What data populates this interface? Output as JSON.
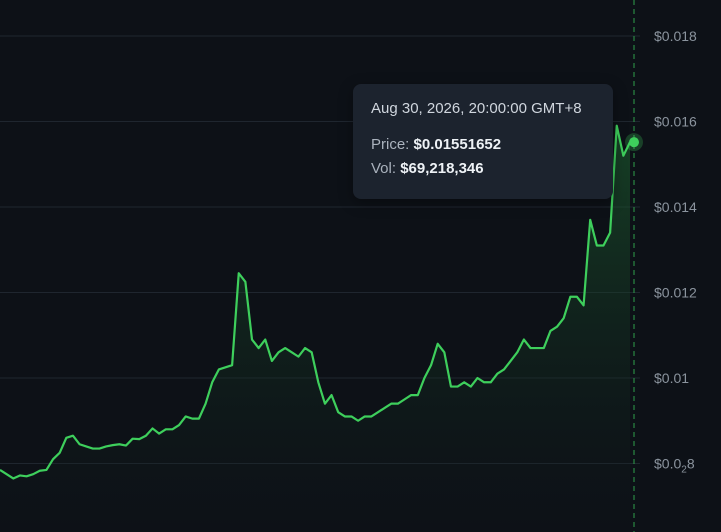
{
  "chart_data": {
    "type": "area",
    "title": "",
    "xlabel": "",
    "ylabel": "",
    "ylim": [
      0.0075,
      0.019
    ],
    "y_ticks": [
      {
        "value": 0.018,
        "label": "$0.018"
      },
      {
        "value": 0.016,
        "label": "$0.016"
      },
      {
        "value": 0.014,
        "label": "$0.014"
      },
      {
        "value": 0.012,
        "label": "$0.012"
      },
      {
        "value": 0.01,
        "label": "$0.01"
      },
      {
        "value": 0.008,
        "label": "$0.0",
        "label_sub": "2",
        "label_end": "8"
      }
    ],
    "grid": true,
    "legend": "none",
    "line_color": "#3ecf5c",
    "fill_color": "#1f6b33",
    "crosshair_color": "#2f9e4b",
    "series": [
      {
        "values": [
          0.00785,
          0.00775,
          0.00765,
          0.00772,
          0.0077,
          0.00775,
          0.00783,
          0.00785,
          0.0081,
          0.00825,
          0.0086,
          0.00865,
          0.00845,
          0.0084,
          0.00835,
          0.00835,
          0.0084,
          0.00843,
          0.00845,
          0.00842,
          0.00858,
          0.00857,
          0.00865,
          0.00882,
          0.0087,
          0.0088,
          0.0088,
          0.0089,
          0.0091,
          0.00905,
          0.00905,
          0.0094,
          0.0099,
          0.0102,
          0.01025,
          0.0103,
          0.01245,
          0.01225,
          0.0109,
          0.0107,
          0.0109,
          0.0104,
          0.0106,
          0.0107,
          0.0106,
          0.0105,
          0.0107,
          0.0106,
          0.0099,
          0.0094,
          0.0096,
          0.0092,
          0.0091,
          0.0091,
          0.009,
          0.0091,
          0.0091,
          0.0092,
          0.0093,
          0.0094,
          0.0094,
          0.0095,
          0.0096,
          0.0096,
          0.01,
          0.0103,
          0.0108,
          0.0106,
          0.0098,
          0.0098,
          0.0099,
          0.0098,
          0.01,
          0.0099,
          0.0099,
          0.0101,
          0.0102,
          0.0104,
          0.0106,
          0.0109,
          0.0107,
          0.0107,
          0.0107,
          0.0111,
          0.0112,
          0.0114,
          0.0119,
          0.0119,
          0.0117,
          0.0137,
          0.0131,
          0.0131,
          0.0134,
          0.0159,
          0.0152,
          0.01551652
        ]
      }
    ]
  },
  "tooltip": {
    "date": "Aug 30, 2026, 20:00:00 GMT+8",
    "price_label": "Price:",
    "price_value": "$0.01551652",
    "vol_label": "Vol:",
    "vol_value": "$69,218,346"
  }
}
